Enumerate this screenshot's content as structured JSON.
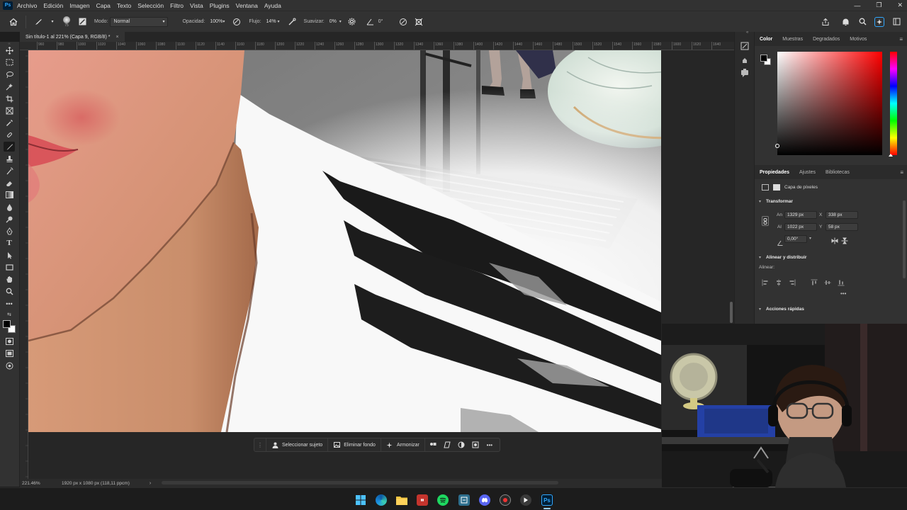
{
  "menubar": {
    "logo": "Ps",
    "items": [
      "Archivo",
      "Edición",
      "Imagen",
      "Capa",
      "Texto",
      "Selección",
      "Filtro",
      "Vista",
      "Plugins",
      "Ventana",
      "Ayuda"
    ]
  },
  "options_bar": {
    "brush_size": "75",
    "mode_label": "Modo:",
    "mode_value": "Normal",
    "opacity_label": "Opacidad:",
    "opacity_value": "100%",
    "flow_label": "Flujo:",
    "flow_value": "14%",
    "smoothing_label": "Suavizar:",
    "smoothing_value": "0%",
    "angle_value": "0°"
  },
  "document_tab": {
    "title": "Sin título-1 al 221% (Capa 9, RGB/8) *",
    "close": "×"
  },
  "ruler": {
    "ticks": [
      "960",
      "980",
      "1000",
      "1020",
      "1040",
      "1060",
      "1080",
      "1100",
      "1120",
      "1140",
      "1160",
      "1180",
      "1200",
      "1220",
      "1240",
      "1260",
      "1280",
      "1300",
      "1320",
      "1340",
      "1360",
      "1380",
      "1400",
      "1420",
      "1440",
      "1460",
      "1480",
      "1500",
      "1520",
      "1540",
      "1560",
      "1580",
      "1600",
      "1620",
      "1640",
      "1660"
    ]
  },
  "context_bar": {
    "select_subject": "Seleccionar sujeto",
    "remove_bg": "Eliminar fondo",
    "harmonize": "Armonizar"
  },
  "status_bar": {
    "zoom": "221.46%",
    "doc_size": "1920 px x 1080 px (118,11 ppcm)"
  },
  "color_panel": {
    "tabs": [
      "Color",
      "Muestras",
      "Degradados",
      "Motivos"
    ],
    "active_tab": "Color"
  },
  "properties_panel": {
    "tabs": [
      "Propiedades",
      "Ajustes",
      "Bibliotecas"
    ],
    "active_tab": "Propiedades",
    "layer_type": "Capa de píxeles",
    "transform": {
      "title": "Transformar",
      "w_label": "An",
      "w_value": "1329 px",
      "x_label": "X",
      "x_value": "338 px",
      "h_label": "Al",
      "h_value": "1022 px",
      "y_label": "Y",
      "y_value": "58 px",
      "angle_value": "0,00°"
    },
    "align": {
      "title": "Alinear y distribuir",
      "label": "Alinear:"
    },
    "quick_actions": {
      "title": "Acciones rápidas"
    }
  },
  "taskbar": {
    "icons": [
      "windows-start",
      "edge",
      "file-explorer",
      "voice-meeter",
      "spotify",
      "app-square",
      "discord",
      "obs-record",
      "media-player",
      "photoshop"
    ]
  },
  "colors": {
    "accent": "#31a8ff",
    "panel_bg": "#323232",
    "foreground_swatch": "#000000",
    "background_swatch": "#ffffff"
  }
}
